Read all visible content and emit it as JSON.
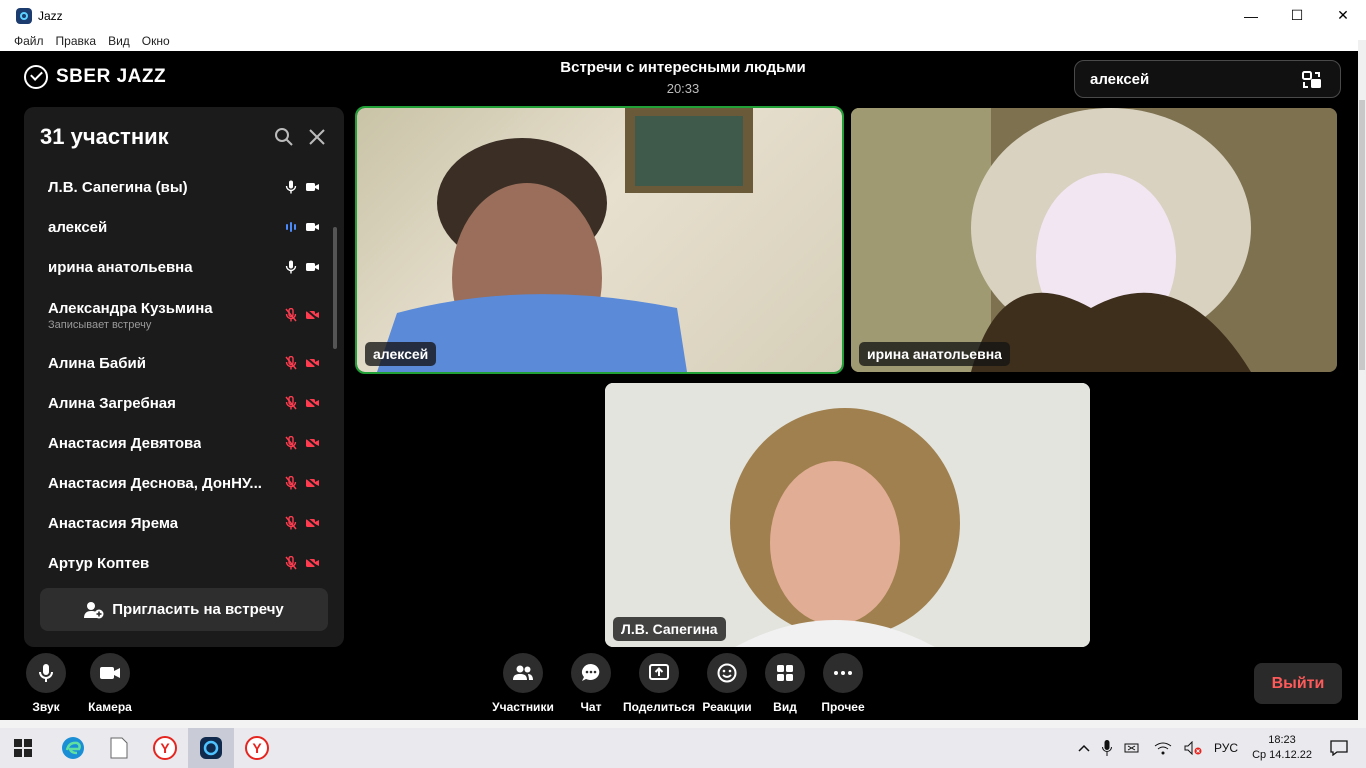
{
  "window": {
    "title": "Jazz",
    "menu": [
      "Файл",
      "Правка",
      "Вид",
      "Окно"
    ],
    "controls": {
      "minimize": "—",
      "maximize": "☐",
      "close": "✕"
    }
  },
  "app": {
    "logo_text": "SBER JAZZ",
    "meeting_title": "Встречи с интересными людьми",
    "meeting_time": "20:33",
    "pinned_name": "алексей"
  },
  "participants": {
    "title": "31 участник",
    "items": [
      {
        "name": "Л.В. Сапегина (вы)",
        "subtitle": "",
        "mic": "on",
        "cam": "on"
      },
      {
        "name": "алексей",
        "subtitle": "",
        "mic": "speaking",
        "cam": "on"
      },
      {
        "name": "ирина анатольевна",
        "subtitle": "",
        "mic": "on",
        "cam": "on"
      },
      {
        "name": "Александра Кузьмина",
        "subtitle": "Записывает встречу",
        "mic": "off",
        "cam": "off"
      },
      {
        "name": "Алина Бабий",
        "subtitle": "",
        "mic": "off",
        "cam": "off"
      },
      {
        "name": "Алина Загребная",
        "subtitle": "",
        "mic": "off",
        "cam": "off"
      },
      {
        "name": "Анастасия Девятова",
        "subtitle": "",
        "mic": "off",
        "cam": "off"
      },
      {
        "name": "Анастасия Деснова, ДонНУ...",
        "subtitle": "",
        "mic": "off",
        "cam": "off"
      },
      {
        "name": "Анастасия Ярема",
        "subtitle": "",
        "mic": "off",
        "cam": "off"
      },
      {
        "name": "Артур Коптев",
        "subtitle": "",
        "mic": "off",
        "cam": "off"
      }
    ],
    "invite_label": "Пригласить на встречу"
  },
  "videos": [
    {
      "label": "алексей",
      "active": true
    },
    {
      "label": "ирина анатольевна",
      "active": false
    },
    {
      "label": "Л.В. Сапегина",
      "active": false
    }
  ],
  "controls": {
    "sound": "Звук",
    "camera": "Камера",
    "participants": "Участники",
    "chat": "Чат",
    "share": "Поделиться",
    "reactions": "Реакции",
    "view": "Вид",
    "more": "Прочее",
    "exit": "Выйти"
  },
  "taskbar": {
    "language": "РУС",
    "time": "18:23",
    "date": "Ср 14.12.22"
  },
  "colors": {
    "accent_green": "#21a038",
    "exit_red": "#ff5a5a",
    "muted_red": "#ff3b4f",
    "speaking_blue": "#4a8cff"
  }
}
